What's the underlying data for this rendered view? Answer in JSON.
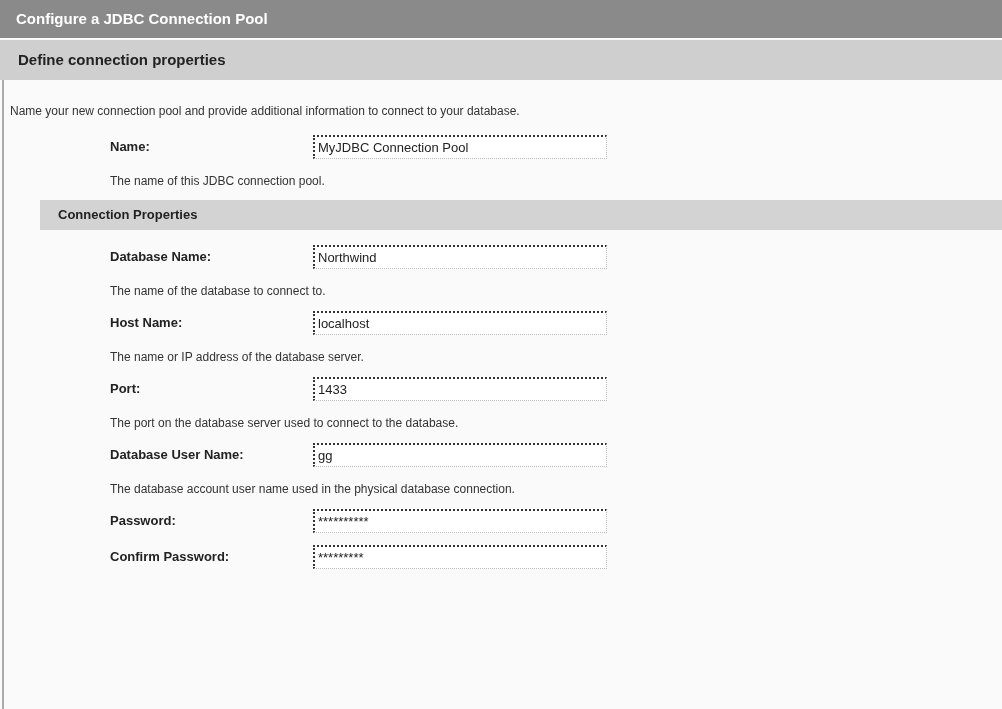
{
  "header": {
    "title": "Configure a JDBC Connection Pool"
  },
  "section": {
    "title": "Define connection properties"
  },
  "intro": "Name your new connection pool and provide additional information to connect to your database.",
  "name_field": {
    "label": "Name:",
    "value": "MyJDBC Connection Pool",
    "help": "The name of this JDBC connection pool."
  },
  "connection_properties": {
    "title": "Connection Properties",
    "fields": [
      {
        "label": "Database Name:",
        "value": "Northwind",
        "help": "The name of the database to connect to."
      },
      {
        "label": "Host Name:",
        "value": "localhost",
        "help": "The name or IP address of the database server."
      },
      {
        "label": "Port:",
        "value": "1433",
        "help": "The port on the database server used to connect to the database."
      },
      {
        "label": "Database User Name:",
        "value": "gg",
        "help": "The database account user name used in the physical database connection."
      },
      {
        "label": "Password:",
        "value": "**********"
      },
      {
        "label": "Confirm Password:",
        "value": "*********"
      }
    ]
  }
}
